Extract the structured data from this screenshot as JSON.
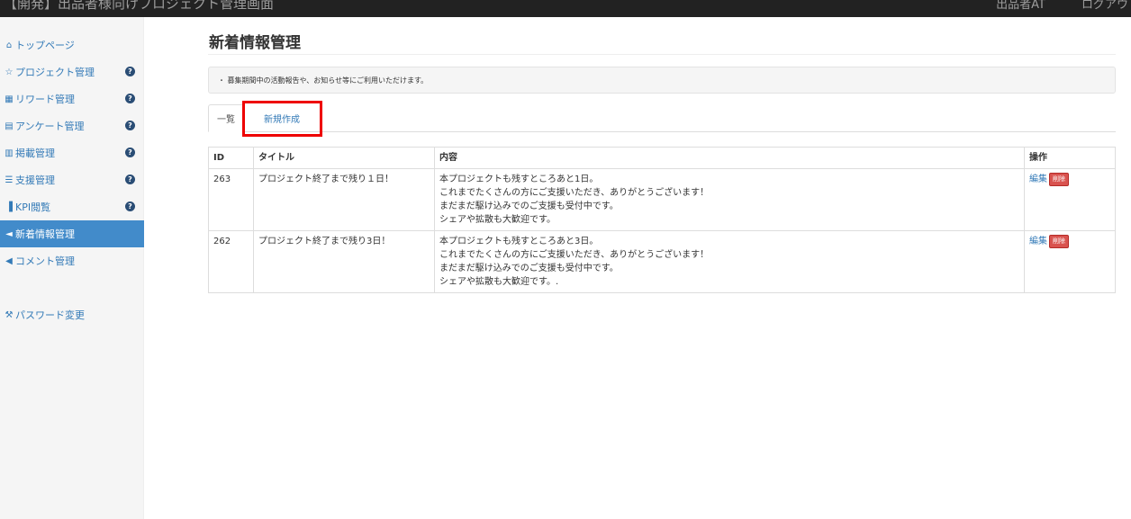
{
  "header": {
    "title": "【開発】出品者様向けプロジェクト管理画面",
    "user_label": "出品者AT",
    "logout_label": "ログアウト"
  },
  "sidebar": {
    "items": [
      {
        "label": "トップページ",
        "icon": "home-icon",
        "glyph": "⌂",
        "has_help": false,
        "active": false
      },
      {
        "label": "プロジェクト管理",
        "icon": "star-icon",
        "glyph": "☆",
        "has_help": true,
        "active": false
      },
      {
        "label": "リワード管理",
        "icon": "grid-icon",
        "glyph": "▦",
        "has_help": true,
        "active": false
      },
      {
        "label": "アンケート管理",
        "icon": "form-icon",
        "glyph": "▤",
        "has_help": true,
        "active": false
      },
      {
        "label": "掲載管理",
        "icon": "listing-icon",
        "glyph": "▥",
        "has_help": true,
        "active": false
      },
      {
        "label": "支援管理",
        "icon": "list-icon",
        "glyph": "☰",
        "has_help": true,
        "active": false
      },
      {
        "label": "KPI閲覧",
        "icon": "bar-chart-icon",
        "glyph": "▐",
        "has_help": true,
        "active": false
      },
      {
        "label": "新着情報管理",
        "icon": "send-icon",
        "glyph": "◄",
        "has_help": false,
        "active": true
      },
      {
        "label": "コメント管理",
        "icon": "megaphone-icon",
        "glyph": "◀",
        "has_help": false,
        "active": false
      }
    ],
    "password_item": {
      "label": "パスワード変更",
      "icon": "wrench-icon",
      "glyph": "⚒"
    },
    "help_glyph": "?"
  },
  "main": {
    "page_title": "新着情報管理",
    "notice": "・ 募集期間中の活動報告や、お知らせ等にご利用いただけます。",
    "tabs": [
      {
        "label": "一覧",
        "active": true
      },
      {
        "label": "新規作成",
        "active": false
      }
    ],
    "table": {
      "headers": [
        "ID",
        "タイトル",
        "内容",
        "操作"
      ],
      "edit_label": "編集",
      "delete_label": "削除",
      "rows": [
        {
          "id": "263",
          "title": "プロジェクト終了まで残り１日！",
          "content": [
            "本プロジェクトも残すところあと1日。",
            "これまでたくさんの方にご支援いただき、ありがとうございます！",
            "まだまだ駆け込みでのご支援も受付中です。",
            "シェアや拡散も大歓迎です。"
          ]
        },
        {
          "id": "262",
          "title": "プロジェクト終了まで残り3日！",
          "content": [
            "本プロジェクトも残すところあと3日。",
            "これまでたくさんの方にご支援いただき、ありがとうございます！",
            "まだまだ駆け込みでのご支援も受付中です。",
            "シェアや拡散も大歓迎です。."
          ]
        }
      ]
    }
  }
}
